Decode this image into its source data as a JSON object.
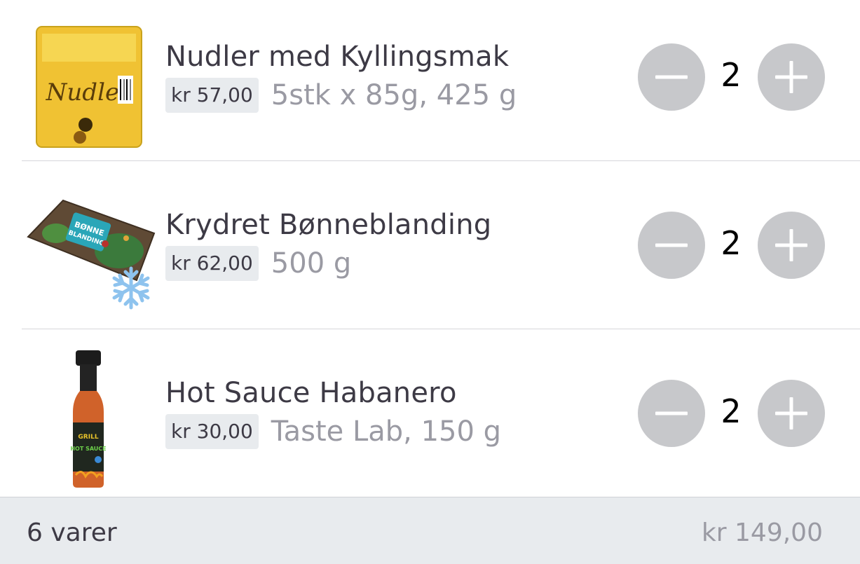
{
  "items": [
    {
      "name": "Nudler med Kyllingsmak",
      "price": "kr 57,00",
      "detail": "5stk x 85g, 425 g",
      "quantity": "2",
      "image_icon": "noodle-pack-icon",
      "frozen": false
    },
    {
      "name": "Krydret Bønneblanding",
      "price": "kr 62,00",
      "detail": "500 g",
      "quantity": "2",
      "image_icon": "bean-mix-bag-icon",
      "frozen": true,
      "frozen_icon": "snowflake-icon"
    },
    {
      "name": "Hot Sauce Habanero",
      "price": "kr 30,00",
      "detail": "Taste Lab, 150 g",
      "quantity": "2",
      "image_icon": "hot-sauce-bottle-icon",
      "frozen": false
    }
  ],
  "footer": {
    "count": "6 varer",
    "total": "kr 149,00"
  },
  "colors": {
    "button_bg": "#c7c8cb",
    "price_bg": "#e8ebee",
    "muted_text": "#9a9aa3",
    "footer_bg": "#e8ebee",
    "frozen_icon": "#8ec3ee"
  }
}
